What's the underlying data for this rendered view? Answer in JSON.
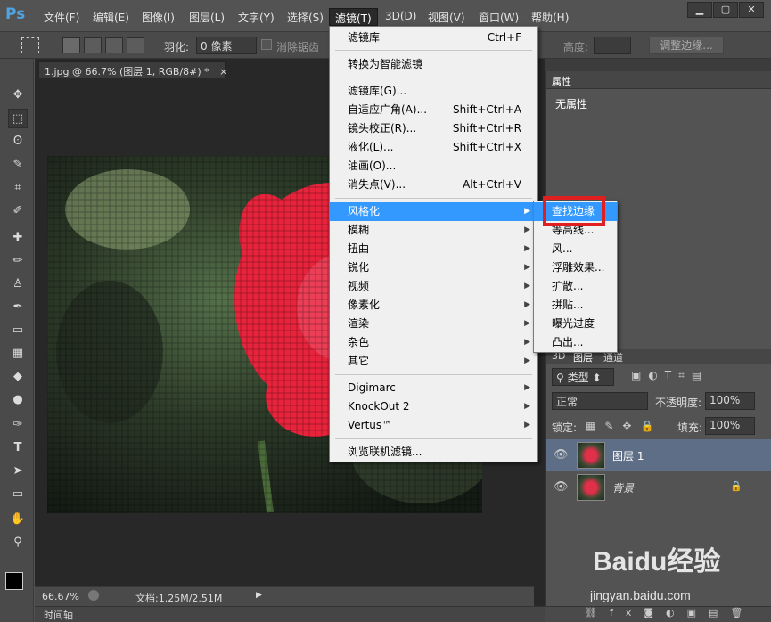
{
  "app": {
    "logo": "Ps"
  },
  "menubar": {
    "items": [
      "文件(F)",
      "编辑(E)",
      "图像(I)",
      "图层(L)",
      "文字(Y)",
      "选择(S)",
      "滤镜(T)",
      "3D(D)",
      "视图(V)",
      "窗口(W)",
      "帮助(H)"
    ],
    "active": "滤镜(T)"
  },
  "window_controls": {
    "minimize": "▁",
    "restore": "▢",
    "close": "✕"
  },
  "options": {
    "feather_label": "羽化:",
    "feather_value": "0 像素",
    "antialias_label": "消除锯齿",
    "height_label": "高度:",
    "refine_edge": "调整边缘..."
  },
  "document": {
    "tab_title": "1.jpg @ 66.7% (图层 1, RGB/8#) *",
    "tab_close": "×"
  },
  "status": {
    "zoom": "66.67%",
    "doc_size": "文档:1.25M/2.51M"
  },
  "timeline": {
    "label": "时间轴"
  },
  "properties": {
    "tab": "属性",
    "content": "无属性"
  },
  "layers_panel": {
    "tabs": [
      "3D",
      "图层",
      "通道"
    ],
    "filter_kind": "类型",
    "blend_mode": "正常",
    "opacity_label": "不透明度:",
    "opacity_value": "100%",
    "lock_label": "锁定:",
    "fill_label": "填充:",
    "fill_value": "100%",
    "layers": [
      {
        "name": "图层 1"
      },
      {
        "name": "背景"
      }
    ]
  },
  "filter_menu": {
    "items": [
      {
        "label": "滤镜库",
        "shortcut": "Ctrl+F"
      },
      {
        "label": "转换为智能滤镜"
      },
      {
        "label": "滤镜库(G)..."
      },
      {
        "label": "自适应广角(A)...",
        "shortcut": "Shift+Ctrl+A"
      },
      {
        "label": "镜头校正(R)...",
        "shortcut": "Shift+Ctrl+R"
      },
      {
        "label": "液化(L)...",
        "shortcut": "Shift+Ctrl+X"
      },
      {
        "label": "油画(O)..."
      },
      {
        "label": "消失点(V)...",
        "shortcut": "Alt+Ctrl+V"
      },
      {
        "label": "风格化"
      },
      {
        "label": "模糊"
      },
      {
        "label": "扭曲"
      },
      {
        "label": "锐化"
      },
      {
        "label": "视频"
      },
      {
        "label": "像素化"
      },
      {
        "label": "渲染"
      },
      {
        "label": "杂色"
      },
      {
        "label": "其它"
      },
      {
        "label": "Digimarc"
      },
      {
        "label": "KnockOut 2"
      },
      {
        "label": "Vertus™"
      },
      {
        "label": "浏览联机滤镜..."
      }
    ]
  },
  "stylize_submenu": {
    "items": [
      "查找边缘",
      "等高线...",
      "风...",
      "浮雕效果...",
      "扩散...",
      "拼贴...",
      "曝光过度",
      "凸出..."
    ]
  },
  "watermark": {
    "brand": "Baidu经验",
    "url": "jingyan.baidu.com"
  },
  "colors": {
    "highlight": "#3399ff",
    "annotation": "#e02020",
    "ps_blue": "#4fa3e0"
  }
}
